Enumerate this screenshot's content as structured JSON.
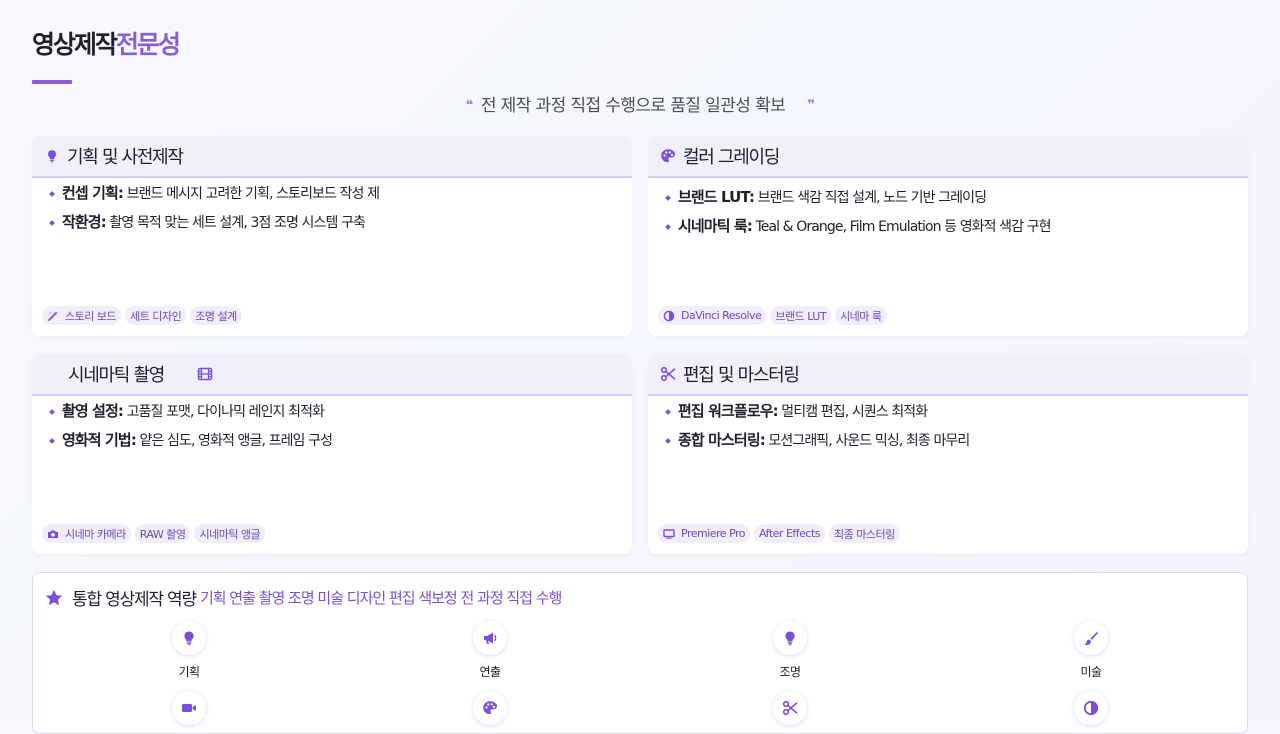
{
  "page": {
    "title_main": "영상제작",
    "title_accent": "전문성",
    "quote": "전 제작 과정 직접 수행으로 품질 일관성 확보"
  },
  "cards": [
    {
      "title": "기획 및 사전제작",
      "icon": "lightbulb-icon",
      "bullets": [
        {
          "key": "컨셉 기획:",
          "text": " 브랜드 메시지 고려한 기획, 스토리보드 작성 제"
        },
        {
          "key": "작환경:",
          "text": " 촬영 목적 맞는 세트 설계, 3점 조명 시스템 구축"
        }
      ],
      "tags": [
        {
          "icon": "magic-wand-icon",
          "label": "스토리 보드"
        },
        {
          "icon": "",
          "label": "세트 디자인"
        },
        {
          "icon": "",
          "label": "조명 설계"
        }
      ]
    },
    {
      "title": "컬러 그레이딩",
      "icon": "palette-icon",
      "bullets": [
        {
          "key": "브랜드 LUT:",
          "text": " 브랜드 색감 직접 설계, 노드 기반 그레이딩"
        },
        {
          "key": "시네마틱 룩:",
          "text": " Teal & Orange, Film Emulation 등 영화적 색감 구현"
        }
      ],
      "tags": [
        {
          "icon": "half-circle-icon",
          "label": "DaVinci Resolve"
        },
        {
          "icon": "",
          "label": "브랜드 LUT"
        },
        {
          "icon": "",
          "label": "시네마 룩"
        }
      ]
    },
    {
      "title": "시네마틱 촬영",
      "icon": "film-icon",
      "bullets": [
        {
          "key": "촬영 설정:",
          "text": " 고품질 포맷, 다이나믹 레인지 최적화"
        },
        {
          "key": "영화적 기법:",
          "text": " 얕은 심도, 영화적 앵글, 프레임 구성"
        }
      ],
      "tags": [
        {
          "icon": "camera-icon",
          "label": "시네마 카메라"
        },
        {
          "icon": "",
          "label": "RAW 촬영"
        },
        {
          "icon": "",
          "label": "시네마틱 앵글"
        }
      ]
    },
    {
      "title": "편집 및 마스터링",
      "icon": "scissors-icon",
      "bullets": [
        {
          "key": "편집 워크플로우:",
          "text": " 멀티캠 편집, 시퀀스 최적화"
        },
        {
          "key": "종합 마스터링:",
          "text": " 모션그래픽, 사운드 믹싱, 최종 마무리"
        }
      ],
      "tags": [
        {
          "icon": "monitor-icon",
          "label": "Premiere Pro"
        },
        {
          "icon": "",
          "label": "After Effects"
        },
        {
          "icon": "",
          "label": "최종 마스터링"
        }
      ]
    }
  ],
  "integrated": {
    "title": "통합 영상제작 역량",
    "subtitle": "기획 연출 촬영 조명 미술 디자인 편집 색보정 전 과정 직접 수행",
    "skills": [
      {
        "icon": "lightbulb-icon",
        "label": "기획"
      },
      {
        "icon": "megaphone-icon",
        "label": "연출"
      },
      {
        "icon": "lightbulb-icon",
        "label": "조명"
      },
      {
        "icon": "paintbrush-icon",
        "label": "미술"
      },
      {
        "icon": "video-camera-icon",
        "label": ""
      },
      {
        "icon": "palette-icon",
        "label": ""
      },
      {
        "icon": "scissors-icon",
        "label": ""
      },
      {
        "icon": "half-circle-icon",
        "label": ""
      }
    ]
  },
  "colors": {
    "accent": "#8b5cd6",
    "header_bg": "#f1effb",
    "tag_bg": "#f1edfb"
  }
}
